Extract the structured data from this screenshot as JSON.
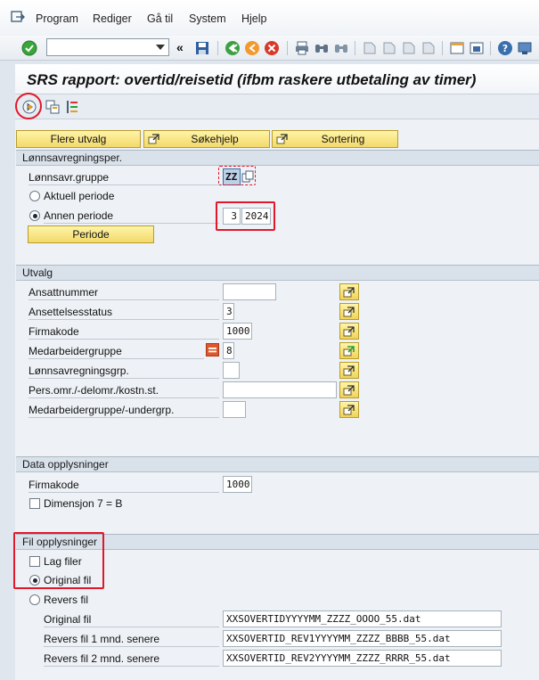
{
  "menu": {
    "items": [
      "Program",
      "Rediger",
      "Gå til",
      "System",
      "Hjelp"
    ]
  },
  "toolbar": {
    "command_value": "",
    "back_glyph": "«"
  },
  "title": "SRS rapport: overtid/reisetid (ifbm raskere utbetaling av timer)",
  "buttons": {
    "flere_utvalg": "Flere utvalg",
    "sokehjelp": "Søkehjelp",
    "sortering": "Sortering"
  },
  "lonn_period": {
    "header": "Lønnsavregningsper.",
    "gruppe_label": "Lønnsavr.gruppe",
    "gruppe_value": "ZZ",
    "aktuell_label": "Aktuell periode",
    "annen_label": "Annen periode",
    "period_month": "3",
    "period_year": "2024",
    "periode_button": "Periode",
    "selected": "annen"
  },
  "utvalg": {
    "header": "Utvalg",
    "rows": [
      {
        "label": "Ansattnummer",
        "value": ""
      },
      {
        "label": "Ansettelsesstatus",
        "value": "3"
      },
      {
        "label": "Firmakode",
        "value": "1000"
      },
      {
        "label": "Medarbeidergruppe",
        "value": "8"
      },
      {
        "label": "Lønnsavregningsgrp.",
        "value": ""
      },
      {
        "label": "Pers.omr./-delomr./kostn.st.",
        "value": ""
      },
      {
        "label": "Medarbeidergruppe/-undergrp.",
        "value": ""
      }
    ]
  },
  "data_oppl": {
    "header": "Data opplysninger",
    "firmakode_label": "Firmakode",
    "firmakode_value": "1000",
    "dimensjon_label": "Dimensjon 7 = B",
    "dimensjon_checked": false
  },
  "fil_oppl": {
    "header": "Fil opplysninger",
    "lag_filer_label": "Lag filer",
    "lag_filer_checked": false,
    "original_label": "Original fil",
    "revers_label": "Revers fil",
    "selected": "original",
    "files": [
      {
        "label": "Original fil",
        "value": "XXSOVERTIDYYYYMM_ZZZZ_OOOO_55.dat"
      },
      {
        "label": "Revers fil 1 mnd. senere",
        "value": "XXSOVERTID_REV1YYYYMM_ZZZZ_BBBB_55.dat"
      },
      {
        "label": "Revers fil 2 mnd. senere",
        "value": "XXSOVERTID_REV2YYYYMM_ZZZZ_RRRR_55.dat"
      }
    ]
  },
  "colors": {
    "accent_red": "#e0182a",
    "button_yellow": "#f3d96a",
    "group_header": "#d9e1ea"
  }
}
